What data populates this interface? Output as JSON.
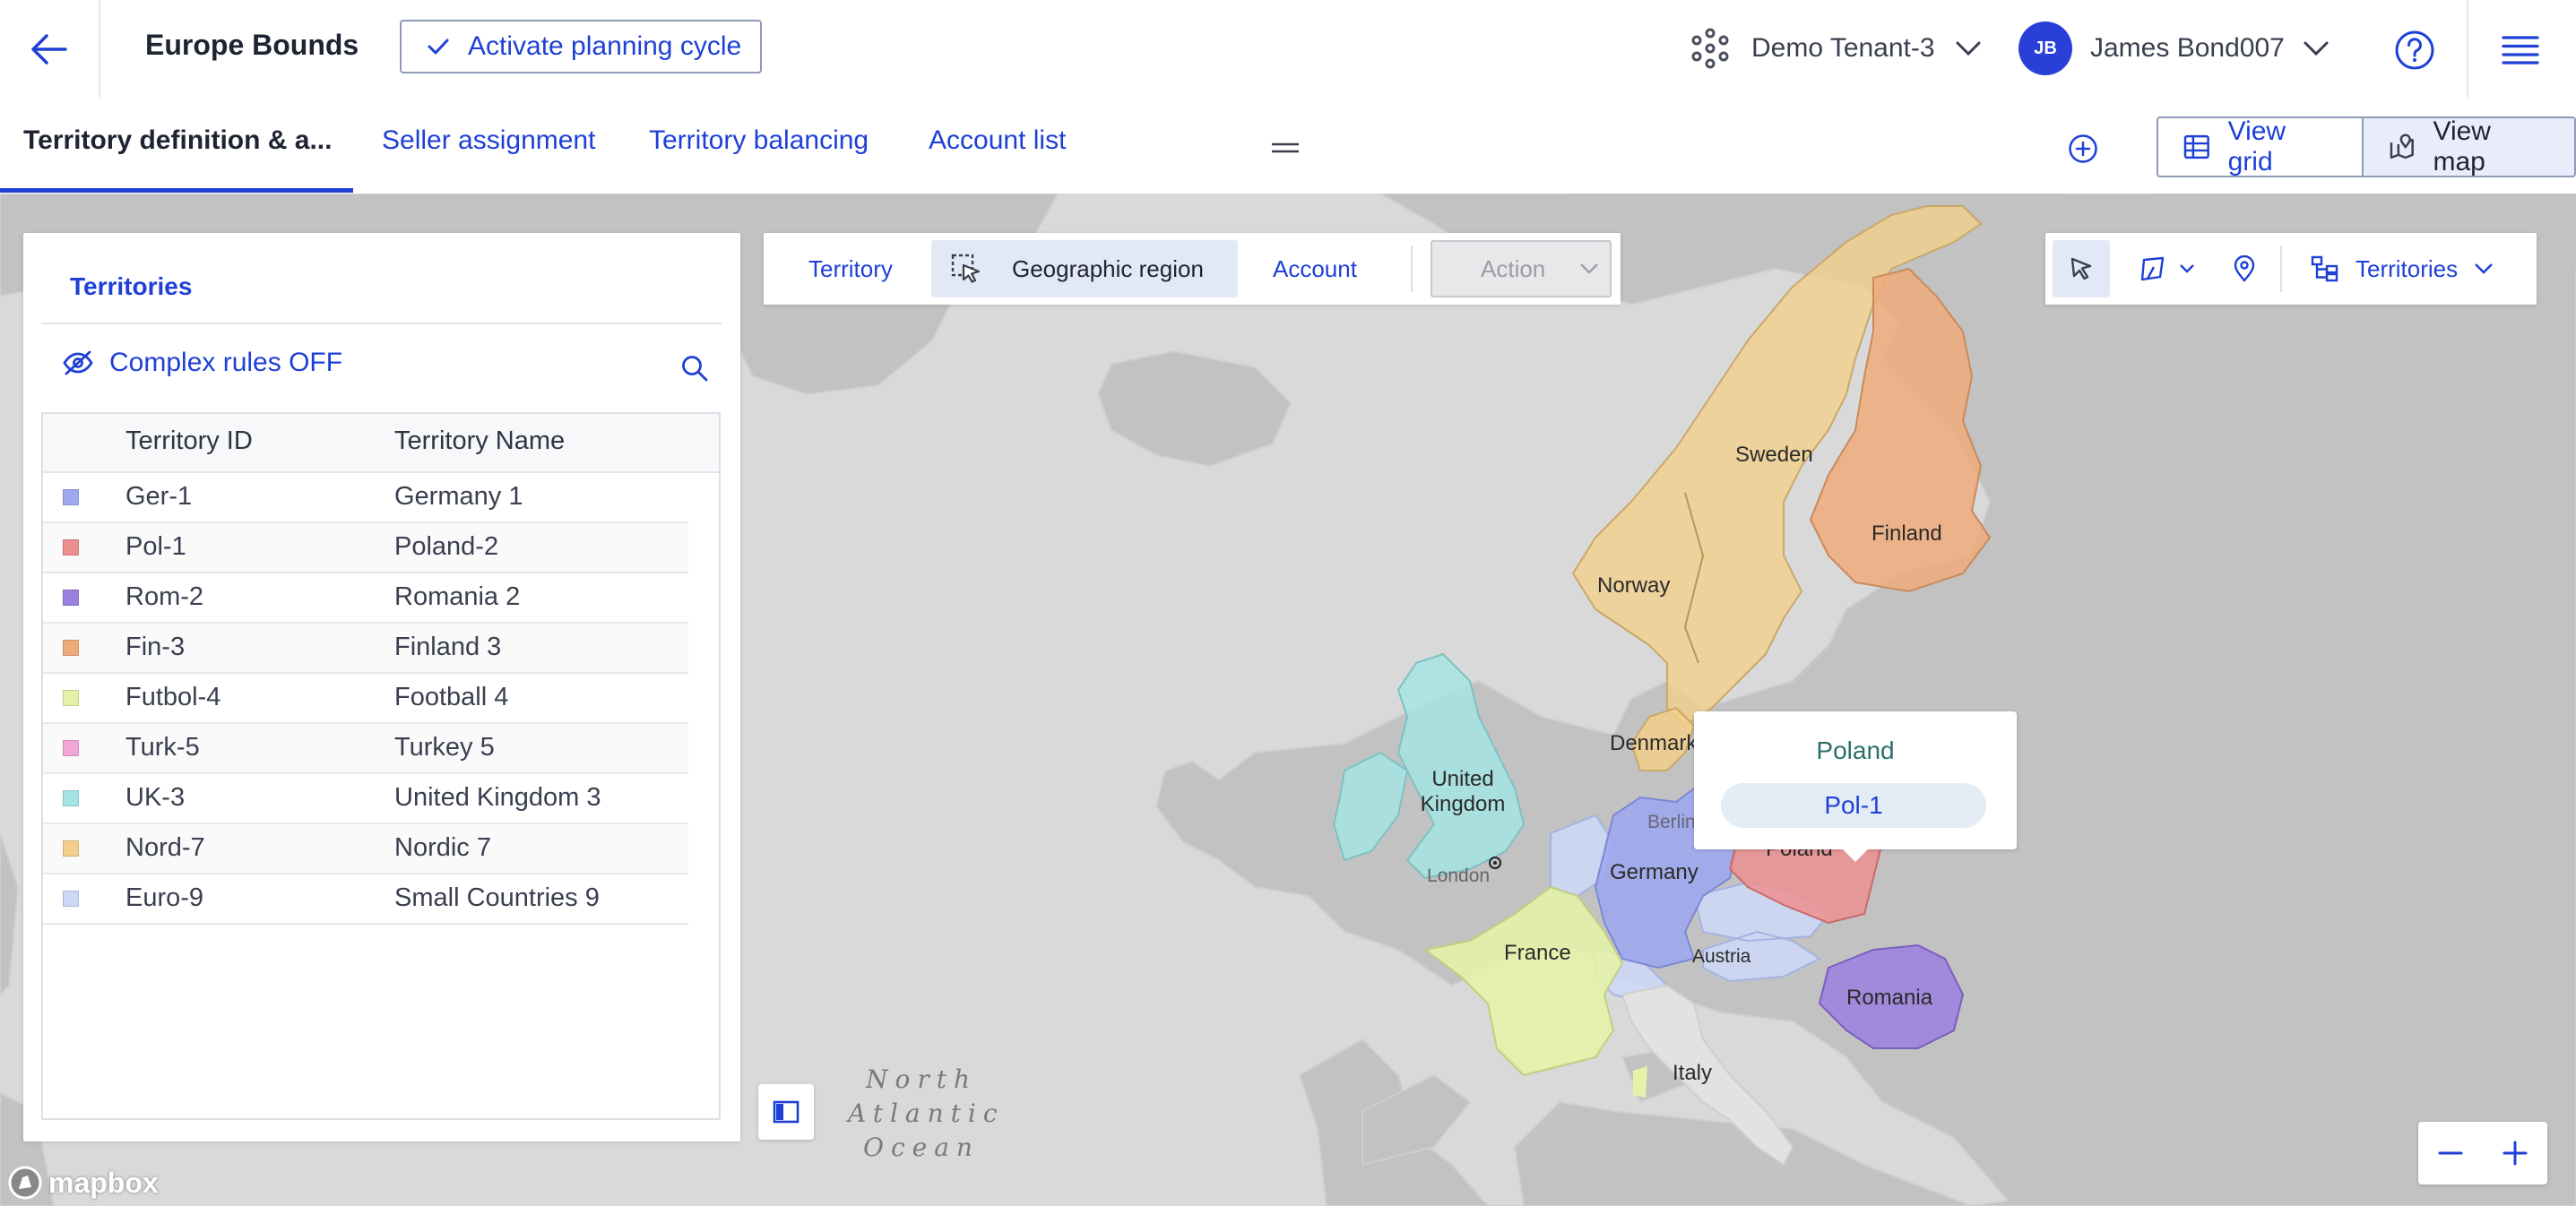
{
  "header": {
    "title": "Europe Bounds",
    "activate_label": "Activate planning cycle",
    "tenant": "Demo Tenant-3",
    "user_initials": "JB",
    "user_name": "James Bond007"
  },
  "tabs": [
    {
      "label": "Territory definition & a...",
      "active": true
    },
    {
      "label": "Seller assignment",
      "active": false
    },
    {
      "label": "Territory balancing",
      "active": false
    },
    {
      "label": "Account list",
      "active": false
    }
  ],
  "view_toggle": {
    "grid": "View grid",
    "map": "View map",
    "active": "map"
  },
  "panel": {
    "title": "Territories",
    "complex_rules": "Complex rules OFF",
    "columns": [
      "Territory ID",
      "Territory Name"
    ],
    "rows": [
      {
        "id": "Ger-1",
        "name": "Germany 1",
        "color": "#9fa9ee"
      },
      {
        "id": "Pol-1",
        "name": "Poland-2",
        "color": "#ec8f8f"
      },
      {
        "id": "Rom-2",
        "name": "Romania 2",
        "color": "#9b7fe0"
      },
      {
        "id": "Fin-3",
        "name": "Finland 3",
        "color": "#efaa7a"
      },
      {
        "id": "Futbol-4",
        "name": "Football 4",
        "color": "#e4f2a8"
      },
      {
        "id": "Turk-5",
        "name": "Turkey 5",
        "color": "#f2a5d6"
      },
      {
        "id": "UK-3",
        "name": "United Kingdom 3",
        "color": "#a6e4e4"
      },
      {
        "id": "Nord-7",
        "name": "Nordic 7",
        "color": "#f2cf8c"
      },
      {
        "id": "Euro-9",
        "name": "Small Countries 9",
        "color": "#cdd8f5"
      }
    ]
  },
  "selection_toolbar": {
    "territory": "Territory",
    "geographic_region": "Geographic region",
    "account": "Account",
    "action": "Action"
  },
  "map_tools": {
    "layer": "Territories"
  },
  "map": {
    "labels": {
      "sweden": "Sweden",
      "finland": "Finland",
      "norway": "Norway",
      "denmark": "Denmark",
      "united_kingdom": "United Kingdom",
      "berlin": "Berlin",
      "london": "London",
      "germany": "Germany",
      "poland": "Poland",
      "france": "France",
      "austria": "Austria",
      "romania": "Romania",
      "italy": "Italy"
    },
    "ocean": "North Atlantic Ocean",
    "attribution": "mapbox"
  },
  "popup": {
    "title": "Poland",
    "chip": "Pol-1"
  },
  "colors": {
    "accent": "#1e40d6",
    "nordic": "#f2cf8c",
    "finland": "#efaa7a",
    "uk": "#a6e4e4",
    "germany": "#9fa9ee",
    "poland": "#ec8f8f",
    "romania": "#9b7fe0",
    "france": "#e4f2a8",
    "small_countries": "#cdd8f5"
  }
}
